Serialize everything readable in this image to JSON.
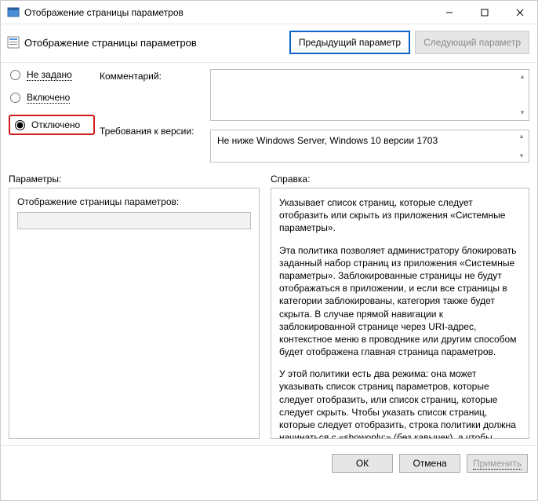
{
  "window": {
    "title": "Отображение страницы параметров"
  },
  "header": {
    "title": "Отображение страницы параметров",
    "prev": "Предыдущий параметр",
    "next": "Следующий параметр"
  },
  "options": {
    "not_configured": "Не задано",
    "enabled": "Включено",
    "disabled": "Отключено"
  },
  "labels": {
    "comment": "Комментарий:",
    "requirements": "Требования к версии:",
    "parameters": "Параметры:",
    "help": "Справка:",
    "param_field": "Отображение страницы параметров:"
  },
  "values": {
    "comment": "",
    "requirements": "Не ниже Windows Server, Windows 10 версии 1703",
    "param_field": ""
  },
  "help": {
    "p1": "Указывает список страниц, которые следует отобразить или скрыть из приложения «Системные параметры».",
    "p2": "Эта политика позволяет администратору блокировать заданный набор страниц из приложения «Системные параметры». Заблокированные страницы не будут отображаться в приложении, и если все страницы в категории заблокированы, категория также будет скрыта. В случае прямой навигации к заблокированной странице через URI-адрес, контекстное меню в проводнике или другим способом будет отображена главная страница параметров.",
    "p3": "У этой политики есть два режима: она может указывать список страниц параметров, которые следует отобразить, или список страниц, которые следует скрыть. Чтобы указать список страниц, которые следует отобразить, строка политики должна начинаться с «showonly:» (без кавычек), а чтобы указать список страниц, которые следует скрыть, она должна начинаться с «hide:». Если страница из списка showonly обычно была бы скрыта по другим причинам"
  },
  "footer": {
    "ok": "ОК",
    "cancel": "Отмена",
    "apply": "Применить"
  }
}
